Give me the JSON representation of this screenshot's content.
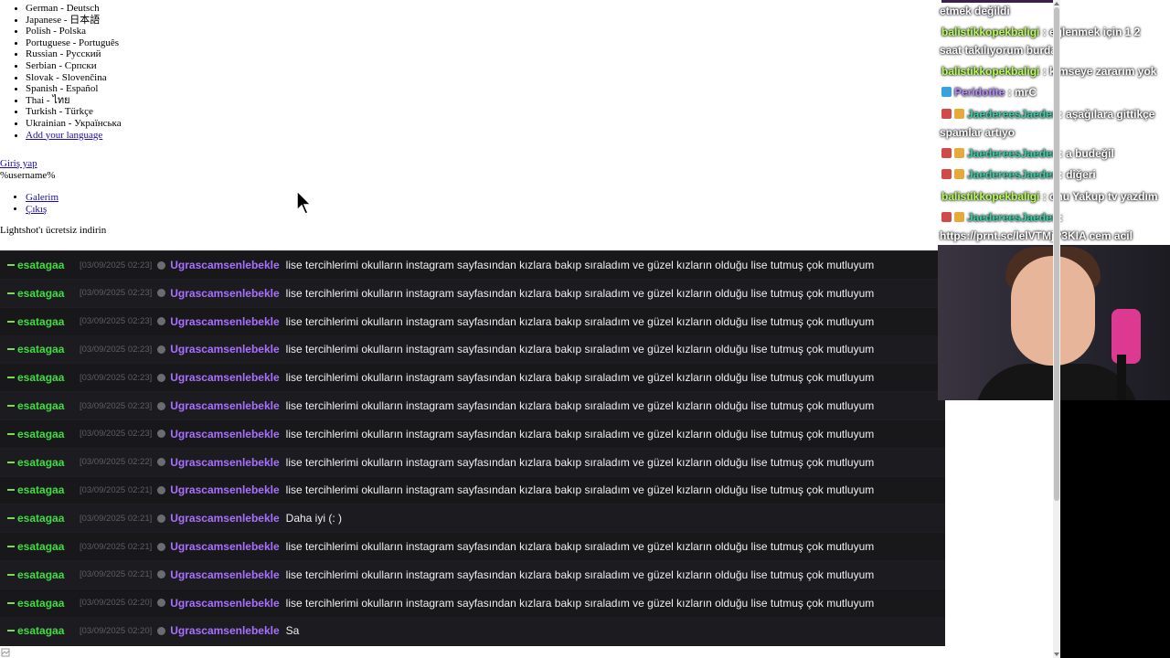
{
  "page": {
    "languages": [
      {
        "label": "German - Deutsch"
      },
      {
        "label": "Japanese - 日本語"
      },
      {
        "label": "Polish - Polska"
      },
      {
        "label": "Portuguese - Português"
      },
      {
        "label": "Russian - Русский"
      },
      {
        "label": "Serbian - Српски"
      },
      {
        "label": "Slovak - Slovenčina"
      },
      {
        "label": "Spanish - Español"
      },
      {
        "label": "Thai - ไทย"
      },
      {
        "label": "Turkish - Türkçe"
      },
      {
        "label": "Ukrainian - Українська"
      }
    ],
    "add_language": "Add your language",
    "login_link": "Giriş yap",
    "username_placeholder": "%username%",
    "menu": {
      "gallery": "Galerim",
      "logout": "Çıkış"
    },
    "download_text": "Lightshot'ı ücretsiz indirin"
  },
  "chat_log": {
    "rows": [
      {
        "mod": "esatagaa",
        "time": "[03/09/2025 02:23]",
        "user": "Ugrascamsenlebekle",
        "message": "lise tercihlerimi okulların instagram sayfasından kızlara bakıp sıraladım ve güzel kızların olduğu lise tutmuş çok mutluyum"
      },
      {
        "mod": "esatagaa",
        "time": "[03/09/2025 02:23]",
        "user": "Ugrascamsenlebekle",
        "message": "lise tercihlerimi okulların instagram sayfasından kızlara bakıp sıraladım ve güzel kızların olduğu lise tutmuş çok mutluyum"
      },
      {
        "mod": "esatagaa",
        "time": "[03/09/2025 02:23]",
        "user": "Ugrascamsenlebekle",
        "message": "lise tercihlerimi okulların instagram sayfasından kızlara bakıp sıraladım ve güzel kızların olduğu lise tutmuş çok mutluyum"
      },
      {
        "mod": "esatagaa",
        "time": "[03/09/2025 02:23]",
        "user": "Ugrascamsenlebekle",
        "message": "lise tercihlerimi okulların instagram sayfasından kızlara bakıp sıraladım ve güzel kızların olduğu lise tutmuş çok mutluyum"
      },
      {
        "mod": "esatagaa",
        "time": "[03/09/2025 02:23]",
        "user": "Ugrascamsenlebekle",
        "message": "lise tercihlerimi okulların instagram sayfasından kızlara bakıp sıraladım ve güzel kızların olduğu lise tutmuş çok mutluyum"
      },
      {
        "mod": "esatagaa",
        "time": "[03/09/2025 02:23]",
        "user": "Ugrascamsenlebekle",
        "message": "lise tercihlerimi okulların instagram sayfasından kızlara bakıp sıraladım ve güzel kızların olduğu lise tutmuş çok mutluyum"
      },
      {
        "mod": "esatagaa",
        "time": "[03/09/2025 02:23]",
        "user": "Ugrascamsenlebekle",
        "message": "lise tercihlerimi okulların instagram sayfasından kızlara bakıp sıraladım ve güzel kızların olduğu lise tutmuş çok mutluyum"
      },
      {
        "mod": "esatagaa",
        "time": "[03/09/2025 02:22]",
        "user": "Ugrascamsenlebekle",
        "message": "lise tercihlerimi okulların instagram sayfasından kızlara bakıp sıraladım ve güzel kızların olduğu lise tutmuş çok mutluyum"
      },
      {
        "mod": "esatagaa",
        "time": "[03/09/2025 02:21]",
        "user": "Ugrascamsenlebekle",
        "message": "lise tercihlerimi okulların instagram sayfasından kızlara bakıp sıraladım ve güzel kızların olduğu lise tutmuş çok mutluyum"
      },
      {
        "mod": "esatagaa",
        "time": "[03/09/2025 02:21]",
        "user": "Ugrascamsenlebekle",
        "message": "Daha iyi (: )"
      },
      {
        "mod": "esatagaa",
        "time": "[03/09/2025 02:21]",
        "user": "Ugrascamsenlebekle",
        "message": "lise tercihlerimi okulların instagram sayfasından kızlara bakıp sıraladım ve güzel kızların olduğu lise tutmuş çok mutluyum"
      },
      {
        "mod": "esatagaa",
        "time": "[03/09/2025 02:21]",
        "user": "Ugrascamsenlebekle",
        "message": "lise tercihlerimi okulların instagram sayfasından kızlara bakıp sıraladım ve güzel kızların olduğu lise tutmuş çok mutluyum"
      },
      {
        "mod": "esatagaa",
        "time": "[03/09/2025 02:20]",
        "user": "Ugrascamsenlebekle",
        "message": "lise tercihlerimi okulların instagram sayfasından kızlara bakıp sıraladım ve güzel kızların olduğu lise tutmuş çok mutluyum"
      },
      {
        "mod": "esatagaa",
        "time": "[03/09/2025 02:20]",
        "user": "Ugrascamsenlebekle",
        "message": "Sa"
      }
    ]
  },
  "overlay_chat": {
    "lines": [
      {
        "prefix": "",
        "user": "",
        "text": "etmek değildi"
      },
      {
        "prefix": "",
        "user": "balistikkopekbaligi",
        "text": " : eğlenmek için 1 2"
      },
      {
        "prefix": "",
        "user": "",
        "text": "saat takılıyorum burda"
      },
      {
        "prefix": "",
        "user": "balistikkopekbaligi",
        "text": " : kimseye zararım yok"
      },
      {
        "prefix": "",
        "user": "Peridotite",
        "text": " : mrC"
      },
      {
        "prefix": "",
        "user": "JaedereesJaeder",
        "text": " : aşağılara gittikçe"
      },
      {
        "prefix": "",
        "user": "",
        "text": "spamlar artıyo"
      },
      {
        "prefix": "",
        "user": "JaedereesJaeder",
        "text": " : a budeğil"
      },
      {
        "prefix": "",
        "user": "JaedereesJaeder",
        "text": " : diğeri"
      },
      {
        "prefix": "",
        "user": "balistikkopekbaligi",
        "text": " : onu Yakup tv yazdım"
      },
      {
        "prefix": "",
        "user": "JaedereesJaeder",
        "text": " :"
      },
      {
        "prefix": "",
        "user": "",
        "text": "https://prnt.sc/lelVTMjP3KIA cem acil"
      }
    ]
  },
  "colors": {
    "mod_green": "#3fdc3f",
    "username_purple": "#a970ff",
    "chat_bg": "#18181b",
    "link_blue": "#1a0dab"
  },
  "icons": {
    "cursor": "mouse-pointer-icon",
    "mod_badge": "sword-icon",
    "status_dot": "dot-icon"
  }
}
